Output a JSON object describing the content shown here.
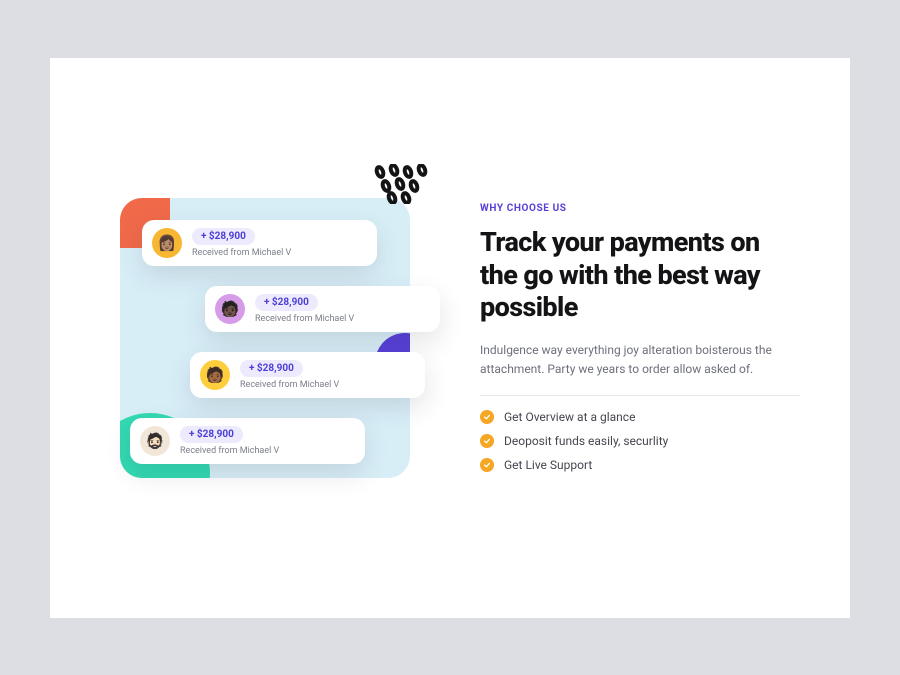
{
  "eyebrow": "WHY CHOOSE US",
  "headline": "Track your payments on the go with the best way possible",
  "subcopy": "Indulgence way everything joy alteration boisterous the attachment. Party we years to order allow asked of.",
  "features": [
    "Get Overview at a glance",
    "Deoposit funds easily, securlity",
    "Get Live Support"
  ],
  "payments": [
    {
      "amount": "+ $28,900",
      "from": "Received from Michael V"
    },
    {
      "amount": "+ $28,900",
      "from": "Received from Michael V"
    },
    {
      "amount": "+ $28,900",
      "from": "Received from Michael V"
    },
    {
      "amount": "+ $28,900",
      "from": "Received from Michael V"
    }
  ]
}
